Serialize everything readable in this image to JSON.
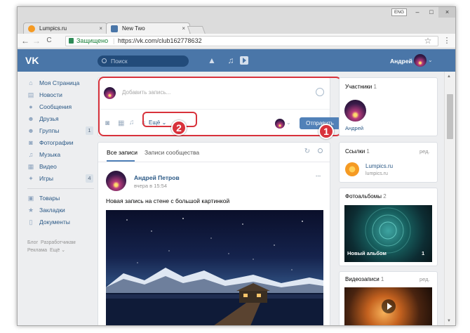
{
  "browser": {
    "tabs": [
      {
        "label": "Lumpics.ru",
        "favicon_color": "#f59a23"
      },
      {
        "label": "New Two",
        "favicon_color": "#4a76a8"
      }
    ],
    "lang_indicator": "ENG",
    "close_glyph": "×",
    "secure_label": "Защищено",
    "url": "https://vk.com/club162778632",
    "nav": {
      "back": "←",
      "forward": "→",
      "reload": "C"
    }
  },
  "header": {
    "logo": "VK",
    "search_placeholder": "Поиск",
    "user_name": "Андрей"
  },
  "sidebar": {
    "items": [
      {
        "label": "Моя Страница",
        "icon": "home-icon"
      },
      {
        "label": "Новости",
        "icon": "news-icon"
      },
      {
        "label": "Сообщения",
        "icon": "messages-icon"
      },
      {
        "label": "Друзья",
        "icon": "friends-icon"
      },
      {
        "label": "Группы",
        "icon": "groups-icon",
        "count": "1"
      },
      {
        "label": "Фотографии",
        "icon": "camera-icon"
      },
      {
        "label": "Музыка",
        "icon": "music-icon"
      },
      {
        "label": "Видео",
        "icon": "video-icon"
      },
      {
        "label": "Игры",
        "icon": "games-icon",
        "count": "4"
      }
    ],
    "items2": [
      {
        "label": "Товары",
        "icon": "bag-icon"
      },
      {
        "label": "Закладки",
        "icon": "star-icon"
      },
      {
        "label": "Документы",
        "icon": "document-icon"
      }
    ],
    "footer": {
      "blog": "Блог",
      "developers": "Разработчикам",
      "ads": "Реклама",
      "more": "Ещё"
    }
  },
  "composer": {
    "placeholder": "Добавить запись...",
    "more_label": "Ещё",
    "send_label": "Отправить"
  },
  "annotations": {
    "one": "1",
    "two": "2"
  },
  "feed": {
    "tabs": [
      "Все записи",
      "Записи сообщества"
    ],
    "post": {
      "author": "Андрей Петров",
      "time": "вчера в 15:54",
      "text": "Новая запись на стене с большой картинкой",
      "menu": "•••"
    }
  },
  "right": {
    "members": {
      "title": "Участники",
      "count": "1",
      "member_name": "Андрей"
    },
    "links": {
      "title": "Ссылки",
      "count": "1",
      "edit": "ред.",
      "name": "Lumpics.ru",
      "url": "lumpics.ru"
    },
    "albums": {
      "title": "Фотоальбомы",
      "count": "2",
      "album_name": "Новый альбом",
      "album_count": "1"
    },
    "videos": {
      "title": "Видеозаписи",
      "count": "1",
      "edit": "ред."
    }
  }
}
